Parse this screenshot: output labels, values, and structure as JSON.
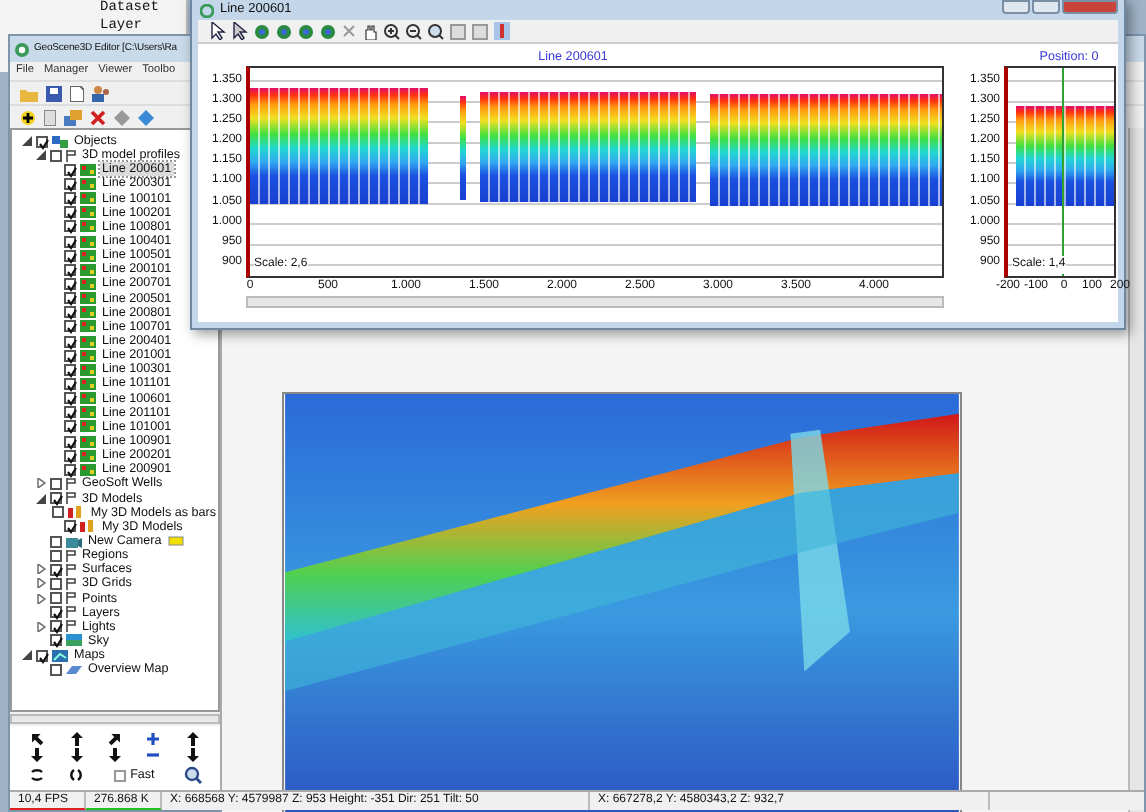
{
  "background_window": {
    "lines": [
      "Dataset",
      "Layer"
    ]
  },
  "main_window": {
    "title": "GeoScene3D Editor [C:\\Users\\Ra",
    "menu": [
      "File",
      "Manager",
      "Viewer",
      "Toolbo"
    ]
  },
  "tree": [
    {
      "label": "Objects",
      "kind": "objects",
      "checked": true,
      "expanded": true,
      "selected": false,
      "children": [
        {
          "label": "3D model profiles",
          "kind": "folder",
          "checked": false,
          "expanded": true,
          "selected": false,
          "children": [
            {
              "label": "Line 200601",
              "kind": "profile",
              "checked": true,
              "selected": true
            },
            {
              "label": "Line 200301",
              "kind": "profile",
              "checked": true,
              "selected": false
            },
            {
              "label": "Line 100101",
              "kind": "profile",
              "checked": true,
              "selected": false
            },
            {
              "label": "Line 100201",
              "kind": "profile",
              "checked": true,
              "selected": false
            },
            {
              "label": "Line 100801",
              "kind": "profile",
              "checked": true,
              "selected": false
            },
            {
              "label": "Line 100401",
              "kind": "profile",
              "checked": true,
              "selected": false
            },
            {
              "label": "Line 100501",
              "kind": "profile",
              "checked": true,
              "selected": false
            },
            {
              "label": "Line 200101",
              "kind": "profile",
              "checked": true,
              "selected": false
            },
            {
              "label": "Line 200701",
              "kind": "profile",
              "checked": true,
              "selected": false
            },
            {
              "label": "Line 200501",
              "kind": "profile",
              "checked": true,
              "selected": false
            },
            {
              "label": "Line 200801",
              "kind": "profile",
              "checked": true,
              "selected": false
            },
            {
              "label": "Line 100701",
              "kind": "profile",
              "checked": true,
              "selected": false
            },
            {
              "label": "Line 200401",
              "kind": "profile",
              "checked": true,
              "selected": false
            },
            {
              "label": "Line 201001",
              "kind": "profile",
              "checked": true,
              "selected": false
            },
            {
              "label": "Line 100301",
              "kind": "profile",
              "checked": true,
              "selected": false
            },
            {
              "label": "Line 101101",
              "kind": "profile",
              "checked": true,
              "selected": false
            },
            {
              "label": "Line 100601",
              "kind": "profile",
              "checked": true,
              "selected": false
            },
            {
              "label": "Line 201101",
              "kind": "profile",
              "checked": true,
              "selected": false
            },
            {
              "label": "Line 101001",
              "kind": "profile",
              "checked": true,
              "selected": false
            },
            {
              "label": "Line 100901",
              "kind": "profile",
              "checked": true,
              "selected": false
            },
            {
              "label": "Line 200201",
              "kind": "profile",
              "checked": true,
              "selected": false
            },
            {
              "label": "Line 200901",
              "kind": "profile",
              "checked": true,
              "selected": false
            }
          ]
        },
        {
          "label": "GeoSoft Wells",
          "kind": "folder",
          "checked": false,
          "expanded": false,
          "selected": false
        },
        {
          "label": "3D Models",
          "kind": "folder",
          "checked": true,
          "expanded": true,
          "selected": false,
          "children": [
            {
              "label": "My 3D Models as bars",
              "kind": "model",
              "checked": false,
              "selected": false
            },
            {
              "label": "My 3D Models",
              "kind": "model",
              "checked": true,
              "selected": false
            }
          ]
        },
        {
          "label": "New Camera",
          "kind": "camera",
          "checked": false,
          "selected": false
        },
        {
          "label": "Regions",
          "kind": "folder",
          "checked": false,
          "selected": false
        },
        {
          "label": "Surfaces",
          "kind": "folder",
          "checked": true,
          "expanded": false,
          "selected": false
        },
        {
          "label": "3D Grids",
          "kind": "folder",
          "checked": false,
          "expanded": false,
          "selected": false
        },
        {
          "label": "Points",
          "kind": "folder",
          "checked": false,
          "expanded": false,
          "selected": false
        },
        {
          "label": "Layers",
          "kind": "folder",
          "checked": true,
          "selected": false
        },
        {
          "label": "Lights",
          "kind": "folder",
          "checked": true,
          "expanded": false,
          "selected": false
        },
        {
          "label": "Sky",
          "kind": "sky",
          "checked": true,
          "selected": false
        }
      ]
    },
    {
      "label": "Maps",
      "kind": "map",
      "checked": true,
      "expanded": true,
      "selected": false,
      "children": [
        {
          "label": "Overview Map",
          "kind": "mapitem",
          "checked": false,
          "selected": false
        }
      ]
    }
  ],
  "navigation": {
    "fast": {
      "label": "Fast",
      "checked": false
    }
  },
  "profile_window": {
    "title": "Line 200601",
    "chart_title": "Line 200601",
    "y_ticks": [
      "1.350",
      "1.300",
      "1.250",
      "1.200",
      "1.150",
      "1.100",
      "1.050",
      "1.000",
      "950",
      "900"
    ],
    "x_ticks": [
      "0",
      "500",
      "1.000",
      "1.500",
      "2.000",
      "2.500",
      "3.000",
      "3.500",
      "4.000"
    ],
    "scale": "Scale: 2,6",
    "position_title": "Position: 0",
    "position_y_ticks": [
      "1.350",
      "1.300",
      "1.250",
      "1.200",
      "1.150",
      "1.100",
      "1.050",
      "1.000",
      "950",
      "900"
    ],
    "position_x_ticks": [
      "-200",
      "-100",
      "0",
      "100",
      "200"
    ],
    "position_scale": "Scale: 1,4"
  },
  "status_bar": {
    "fps": "10,4 FPS",
    "memory": "276.868 K",
    "camera": "X: 668568 Y: 4579987 Z: 953 Height: -351 Dir: 251 Tilt: 50",
    "cursor": "X: 667278,2 Y: 4580343,2 Z: 932,7"
  }
}
